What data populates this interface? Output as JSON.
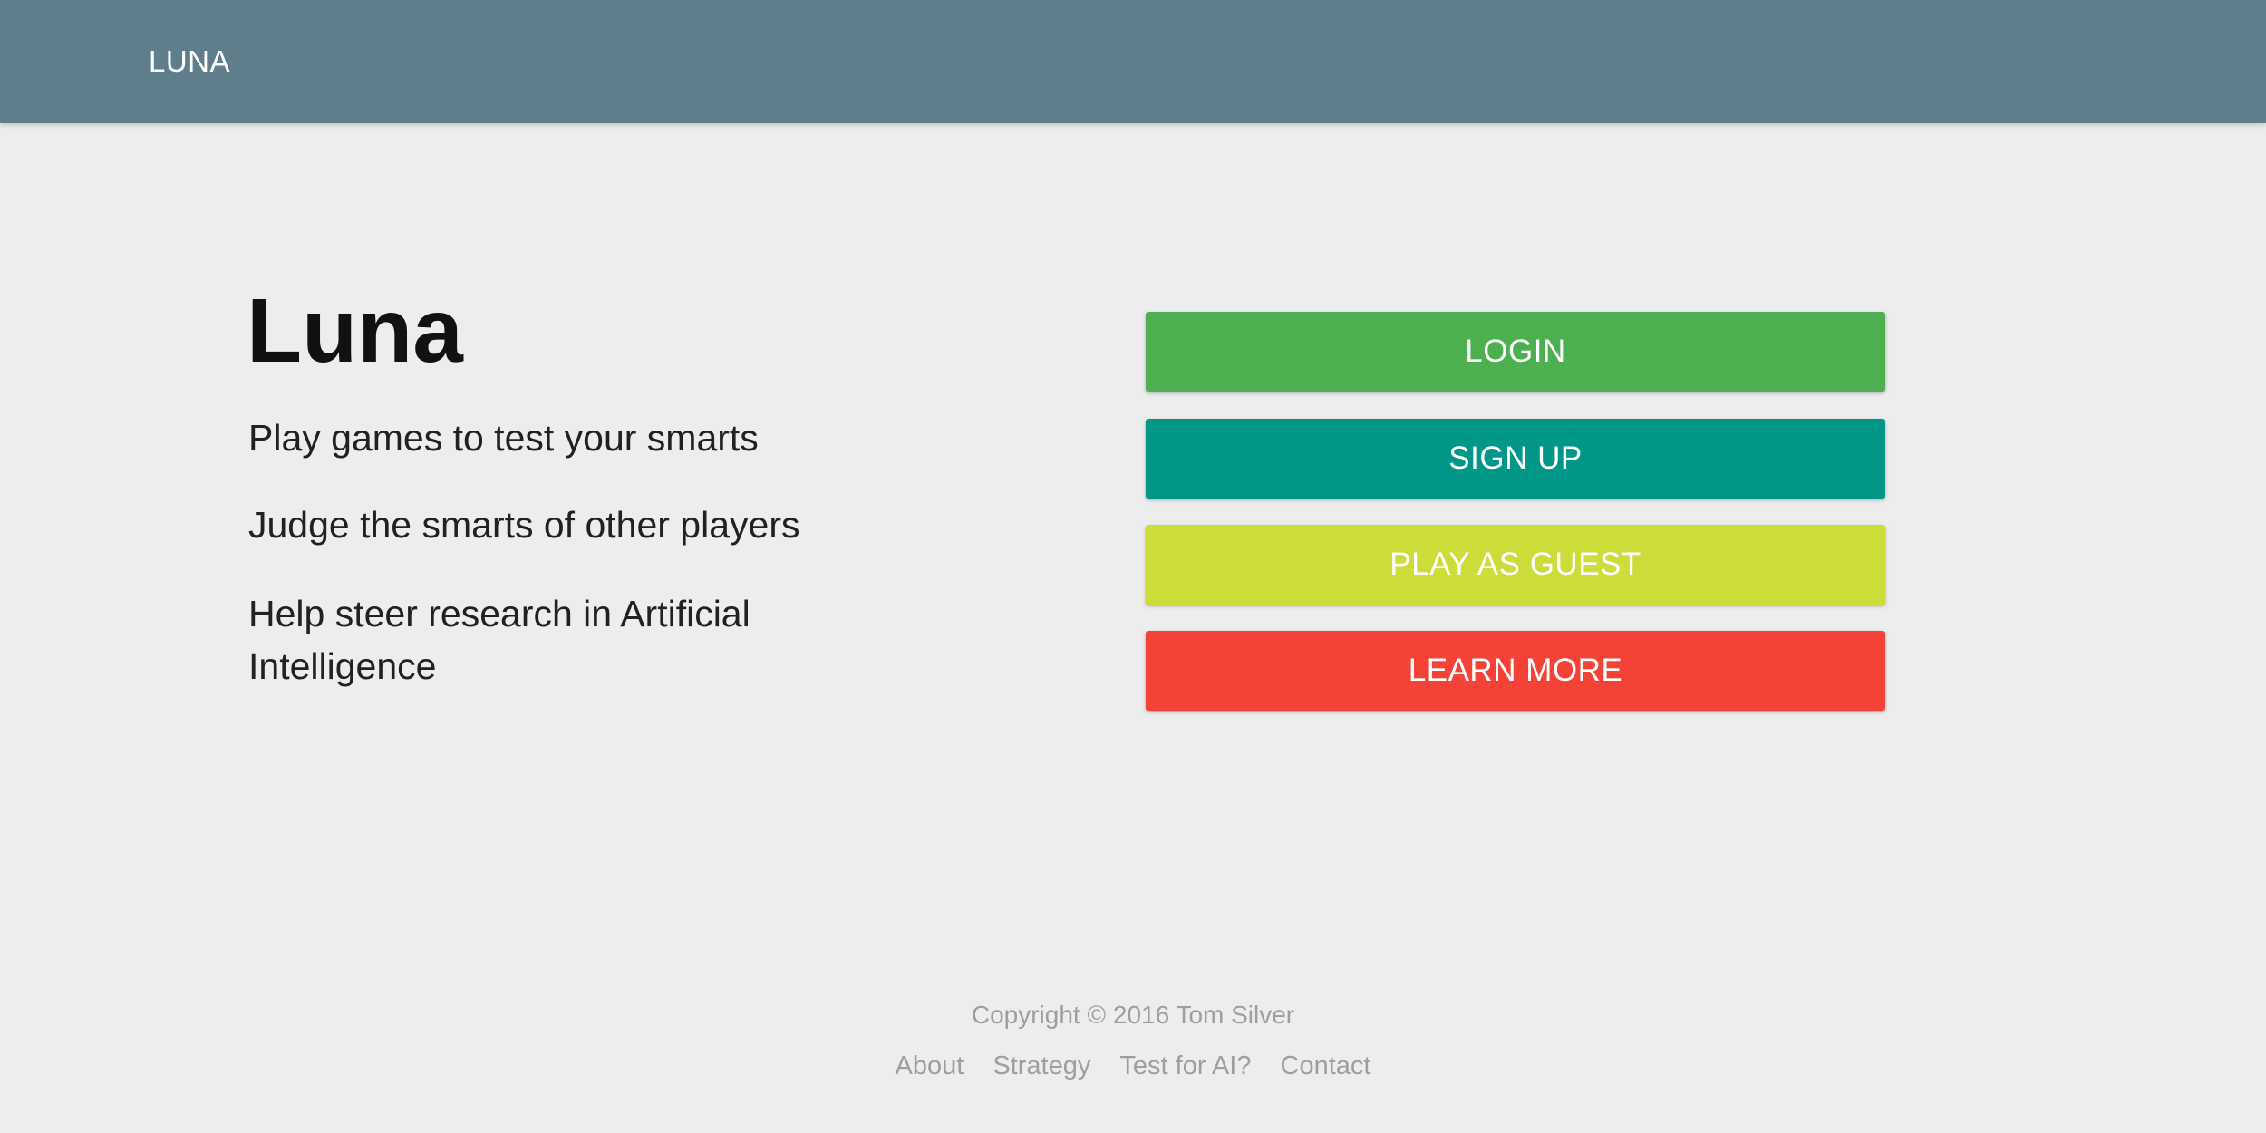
{
  "navbar": {
    "brand": "LUNA",
    "background_color": "#607d8b"
  },
  "hero": {
    "title": "Luna",
    "taglines": [
      "Play games to test your smarts",
      "Judge the smarts of other players",
      "Help steer research in Artificial Intelligence"
    ]
  },
  "actions": {
    "login": {
      "label": "LOGIN",
      "color": "#4caf50"
    },
    "signup": {
      "label": "SIGN UP",
      "color": "#009688"
    },
    "guest": {
      "label": "PLAY AS GUEST",
      "color": "#cddc39"
    },
    "learn_more": {
      "label": "LEARN MORE",
      "color": "#f44336"
    }
  },
  "footer": {
    "copyright": "Copyright © 2016 Tom Silver",
    "links": [
      "About",
      "Strategy",
      "Test for AI?",
      "Contact"
    ]
  },
  "page_background": "#ededed"
}
